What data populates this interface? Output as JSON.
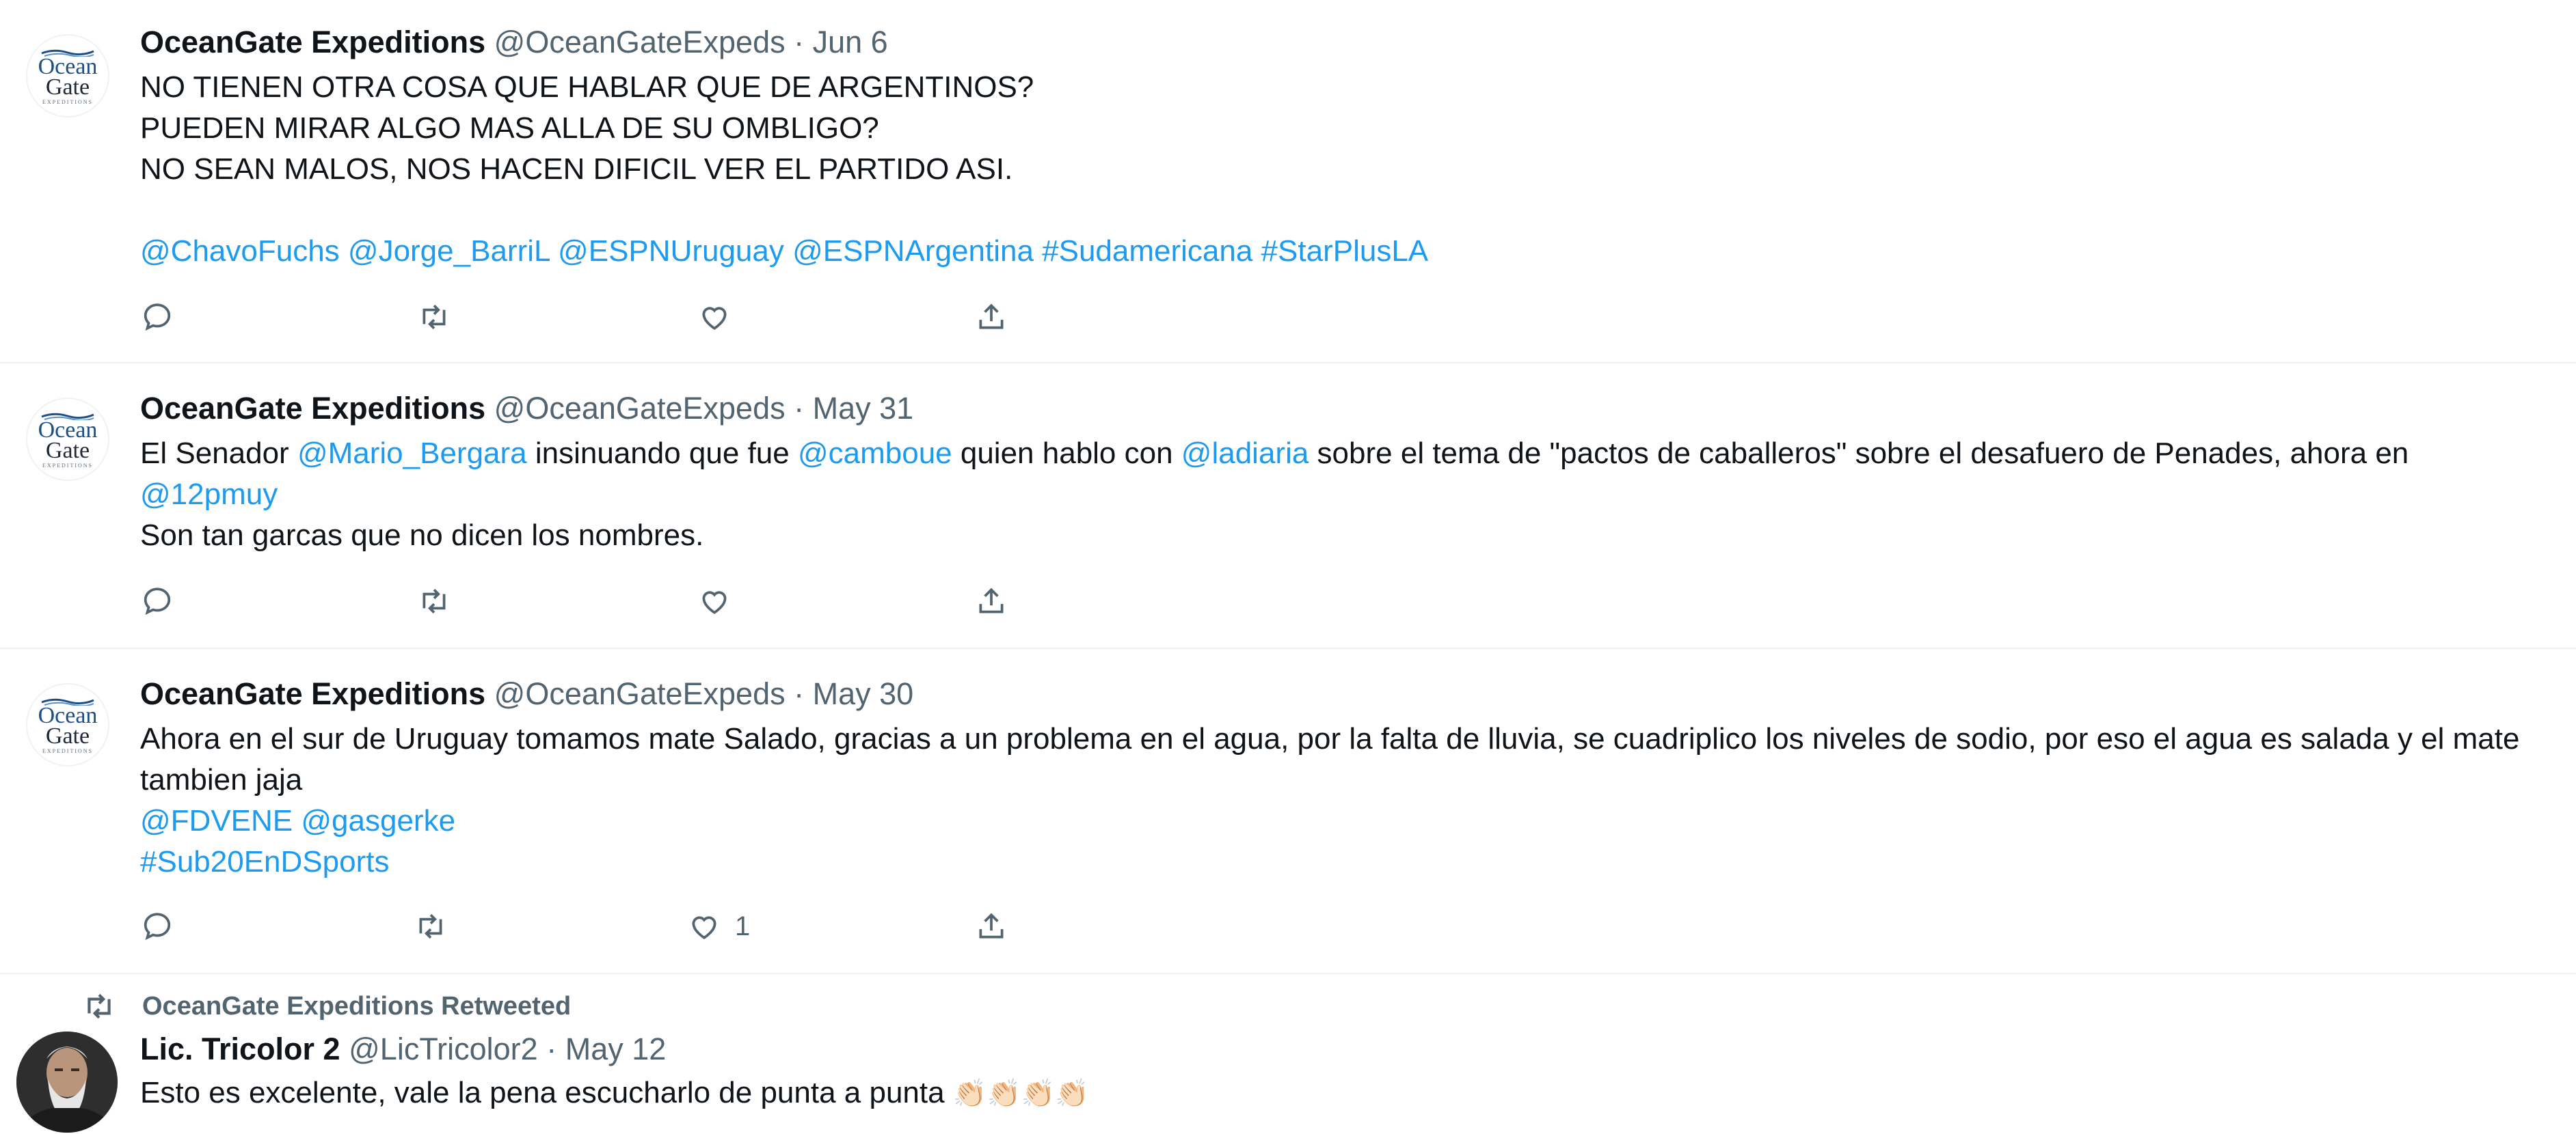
{
  "tweets": [
    {
      "name": "OceanGate Expeditions",
      "handle": "@OceanGateExpeds",
      "sep": "·",
      "date": "Jun 6",
      "lines": [
        "NO TIENEN OTRA COSA QUE HABLAR QUE DE ARGENTINOS?",
        "PUEDEN MIRAR ALGO MAS ALLA DE SU OMBLIGO?",
        "NO SEAN MALOS, NOS HACEN DIFICIL VER EL PARTIDO ASI."
      ],
      "links": "@ChavoFuchs @Jorge_BarriL @ESPNUruguay @ESPNArgentina #Sudamericana #StarPlusLA"
    },
    {
      "name": "OceanGate Expeditions",
      "handle": "@OceanGateExpeds",
      "sep": "·",
      "date": "May 31",
      "t1": "El Senador ",
      "m1": "@Mario_Bergara",
      "t2": " insinuando que fue ",
      "m2": "@camboue",
      "t3": " quien hablo con ",
      "m3": "@ladiaria",
      "t4": " sobre el tema de \"pactos de caballeros\" sobre el desafuero de Penades, ahora en",
      "m4": "@12pmuy",
      "t5": "Son tan garcas que no dicen los nombres."
    },
    {
      "name": "OceanGate Expeditions",
      "handle": "@OceanGateExpeds",
      "sep": "·",
      "date": "May 30",
      "text": "Ahora en el sur de Uruguay tomamos mate Salado, gracias a un problema en el agua, por la falta de lluvia, se cuadriplico los niveles de sodio, por eso el agua es salada y el mate tambien jaja",
      "links1": "@FDVENE @gasgerke",
      "links2": "#Sub20EnDSports",
      "like_count": "1"
    }
  ],
  "retweet": {
    "label": "OceanGate Expeditions Retweeted",
    "name": "Lic. Tricolor 2",
    "handle": "@LicTricolor2",
    "sep": "·",
    "date": "May 12",
    "text": "Esto es excelente, vale la pena escucharlo de punta a punta",
    "emoji": "👏🏻👏🏻👏🏻👏🏻"
  },
  "logo": {
    "line1": "Ocean",
    "line2": "Gate",
    "line3": "EXPEDITIONS"
  },
  "icons": [
    "reply-icon",
    "retweet-icon",
    "like-icon",
    "share-icon"
  ],
  "colors": {
    "link": "#1d9bf0",
    "muted": "#536471",
    "divider": "#eff3f4"
  }
}
